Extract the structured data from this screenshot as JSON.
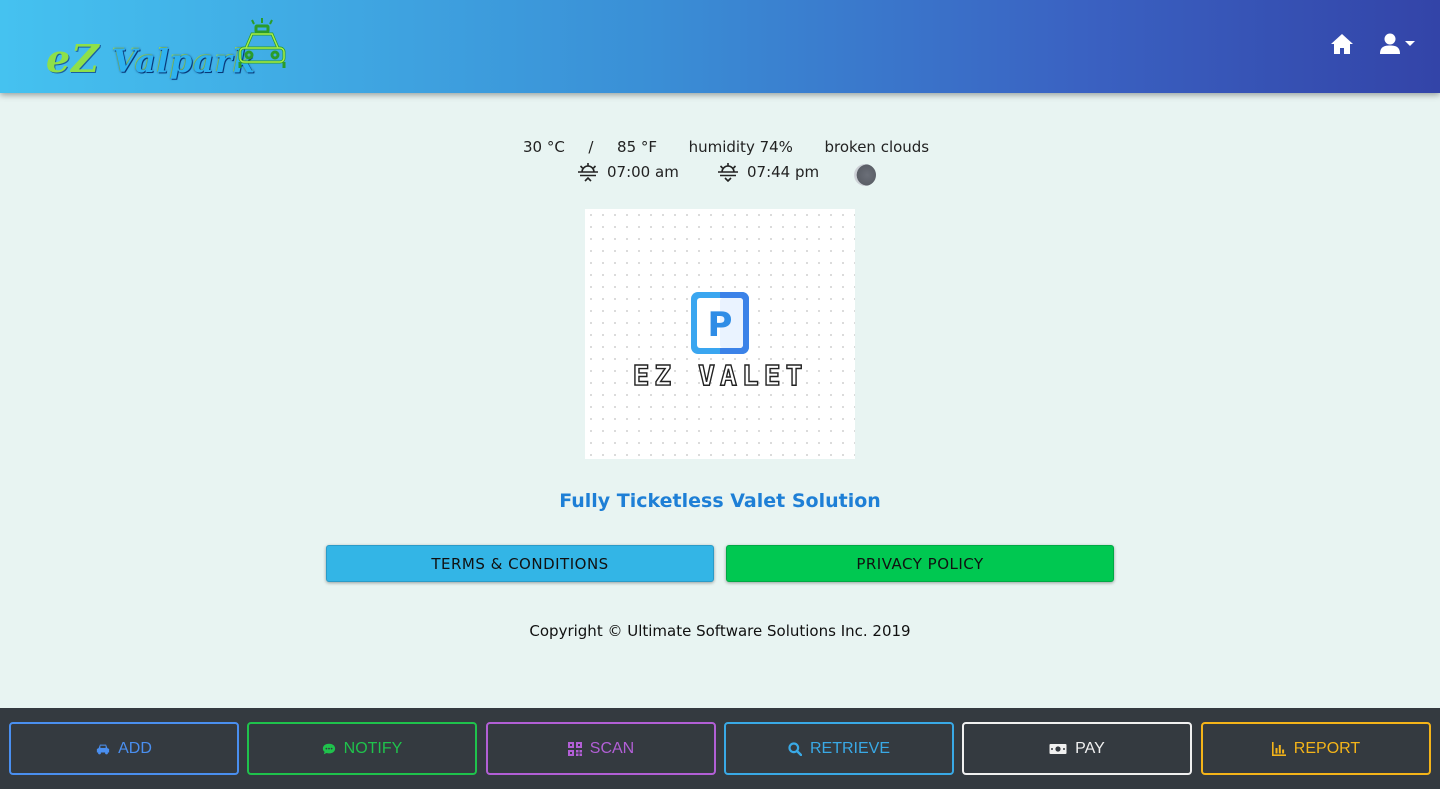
{
  "header": {
    "brand_prefix": "eZ",
    "brand_name": "Valpark",
    "home_icon": "home-icon",
    "user_icon": "user-icon"
  },
  "weather": {
    "temp_c": "30 °C",
    "separator": "/",
    "temp_f": "85 °F",
    "humidity": "humidity 74%",
    "conditions": "broken clouds",
    "sunrise": "07:00 am",
    "sunset": "07:44 pm"
  },
  "logo": {
    "text": "EZ VALET",
    "badge_letter": "P"
  },
  "tagline": "Fully Ticketless Valet Solution",
  "buttons": {
    "terms": "TERMS & CONDITIONS",
    "privacy": "PRIVACY POLICY"
  },
  "copyright": "Copyright © Ultimate Software Solutions Inc. 2019",
  "footer": {
    "buttons": [
      {
        "label": "ADD",
        "icon": "car-icon",
        "color": "#4a8ff0"
      },
      {
        "label": "NOTIFY",
        "icon": "comment-icon",
        "color": "#1fc24c"
      },
      {
        "label": "SCAN",
        "icon": "qrcode-icon",
        "color": "#b25fd6"
      },
      {
        "label": "RETRIEVE",
        "icon": "search-icon",
        "color": "#39a9e6"
      },
      {
        "label": "PAY",
        "icon": "money-icon",
        "color": "#f0f0f0"
      },
      {
        "label": "REPORT",
        "icon": "chart-icon",
        "color": "#f4b419"
      }
    ]
  },
  "colors": {
    "background": "#e8f4f2",
    "tagline": "#1e7fd6",
    "terms_button": "#33b5e6",
    "privacy_button": "#00c851",
    "footer": "#343a40"
  }
}
